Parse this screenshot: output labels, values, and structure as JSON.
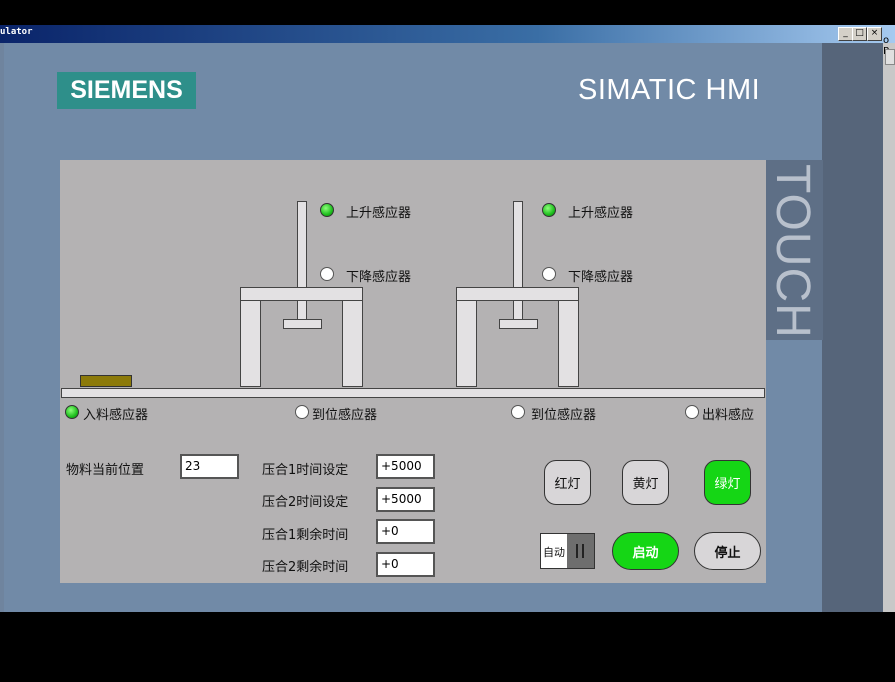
{
  "window": {
    "title": "ulator",
    "buttons": [
      "_",
      "□",
      "×"
    ]
  },
  "side_text": "o R",
  "brand": {
    "logo": "SIEMENS",
    "product": "SIMATIC HMI",
    "vertical": "TOUCH"
  },
  "sensors": {
    "station1_up": {
      "label": "上升感应器",
      "state": "on"
    },
    "station1_down": {
      "label": "下降感应器",
      "state": "off"
    },
    "station2_up": {
      "label": "上升感应器",
      "state": "on"
    },
    "station2_down": {
      "label": "下降感应器",
      "state": "off"
    },
    "infeed": {
      "label": "入料感应器",
      "state": "on"
    },
    "arrive1": {
      "label": "到位感应器",
      "state": "off"
    },
    "arrive2": {
      "label": "到位感应器",
      "state": "off"
    },
    "outfeed": {
      "label": "出料感应",
      "state": "off"
    }
  },
  "material": {
    "label": "物料当前位置",
    "value": "23"
  },
  "timers": [
    {
      "label": "压合1时间设定",
      "value": "+5000"
    },
    {
      "label": "压合2时间设定",
      "value": "+5000"
    },
    {
      "label": "压合1剩余时间",
      "value": "+0"
    },
    {
      "label": "压合2剩余时间",
      "value": "+0"
    }
  ],
  "lamps": {
    "red": "红灯",
    "yellow": "黄灯",
    "green": "绿灯",
    "active": "green"
  },
  "controls": {
    "mode": "自动",
    "start": "启动",
    "stop": "停止"
  },
  "colors": {
    "led_on": "#1fbf1f",
    "start_button": "#15d615",
    "logo_bg": "#2e8f8a",
    "panel_bg": "#b4b2b3"
  }
}
